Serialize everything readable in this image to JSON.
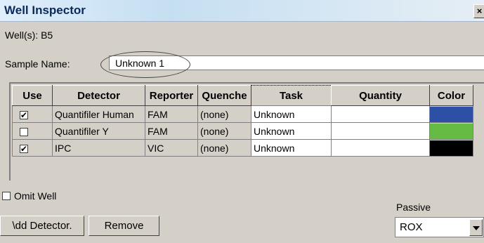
{
  "window": {
    "title": "Well Inspector",
    "close_label": "×"
  },
  "wells": {
    "label": "Well(s): B5"
  },
  "sample": {
    "label": "Sample Name:",
    "value": "Unknown 1"
  },
  "table": {
    "headers": {
      "use": "Use",
      "detector": "Detector",
      "reporter": "Reporter",
      "quencher": "Quenche",
      "task": "Task",
      "quantity": "Quantity",
      "color": "Color"
    },
    "rows": [
      {
        "use": true,
        "use_mark": "✔",
        "detector": "Quantifiler Human",
        "reporter": "FAM",
        "quencher": "(none)",
        "task": "Unknown",
        "quantity": "",
        "color": "#2e4fa6"
      },
      {
        "use": false,
        "use_mark": "",
        "detector": "Quantifiler Y",
        "reporter": "FAM",
        "quencher": "(none)",
        "task": "Unknown",
        "quantity": "",
        "color": "#66bb44"
      },
      {
        "use": true,
        "use_mark": "✔",
        "detector": "IPC",
        "reporter": "VIC",
        "quencher": "(none)",
        "task": "Unknown",
        "quantity": "",
        "color": "#000000"
      }
    ]
  },
  "omit_well": {
    "label": "Omit Well",
    "checked": false
  },
  "buttons": {
    "add_detector": "\\dd Detector.",
    "remove": "Remove"
  },
  "passive": {
    "label": "Passive",
    "value": "ROX"
  }
}
